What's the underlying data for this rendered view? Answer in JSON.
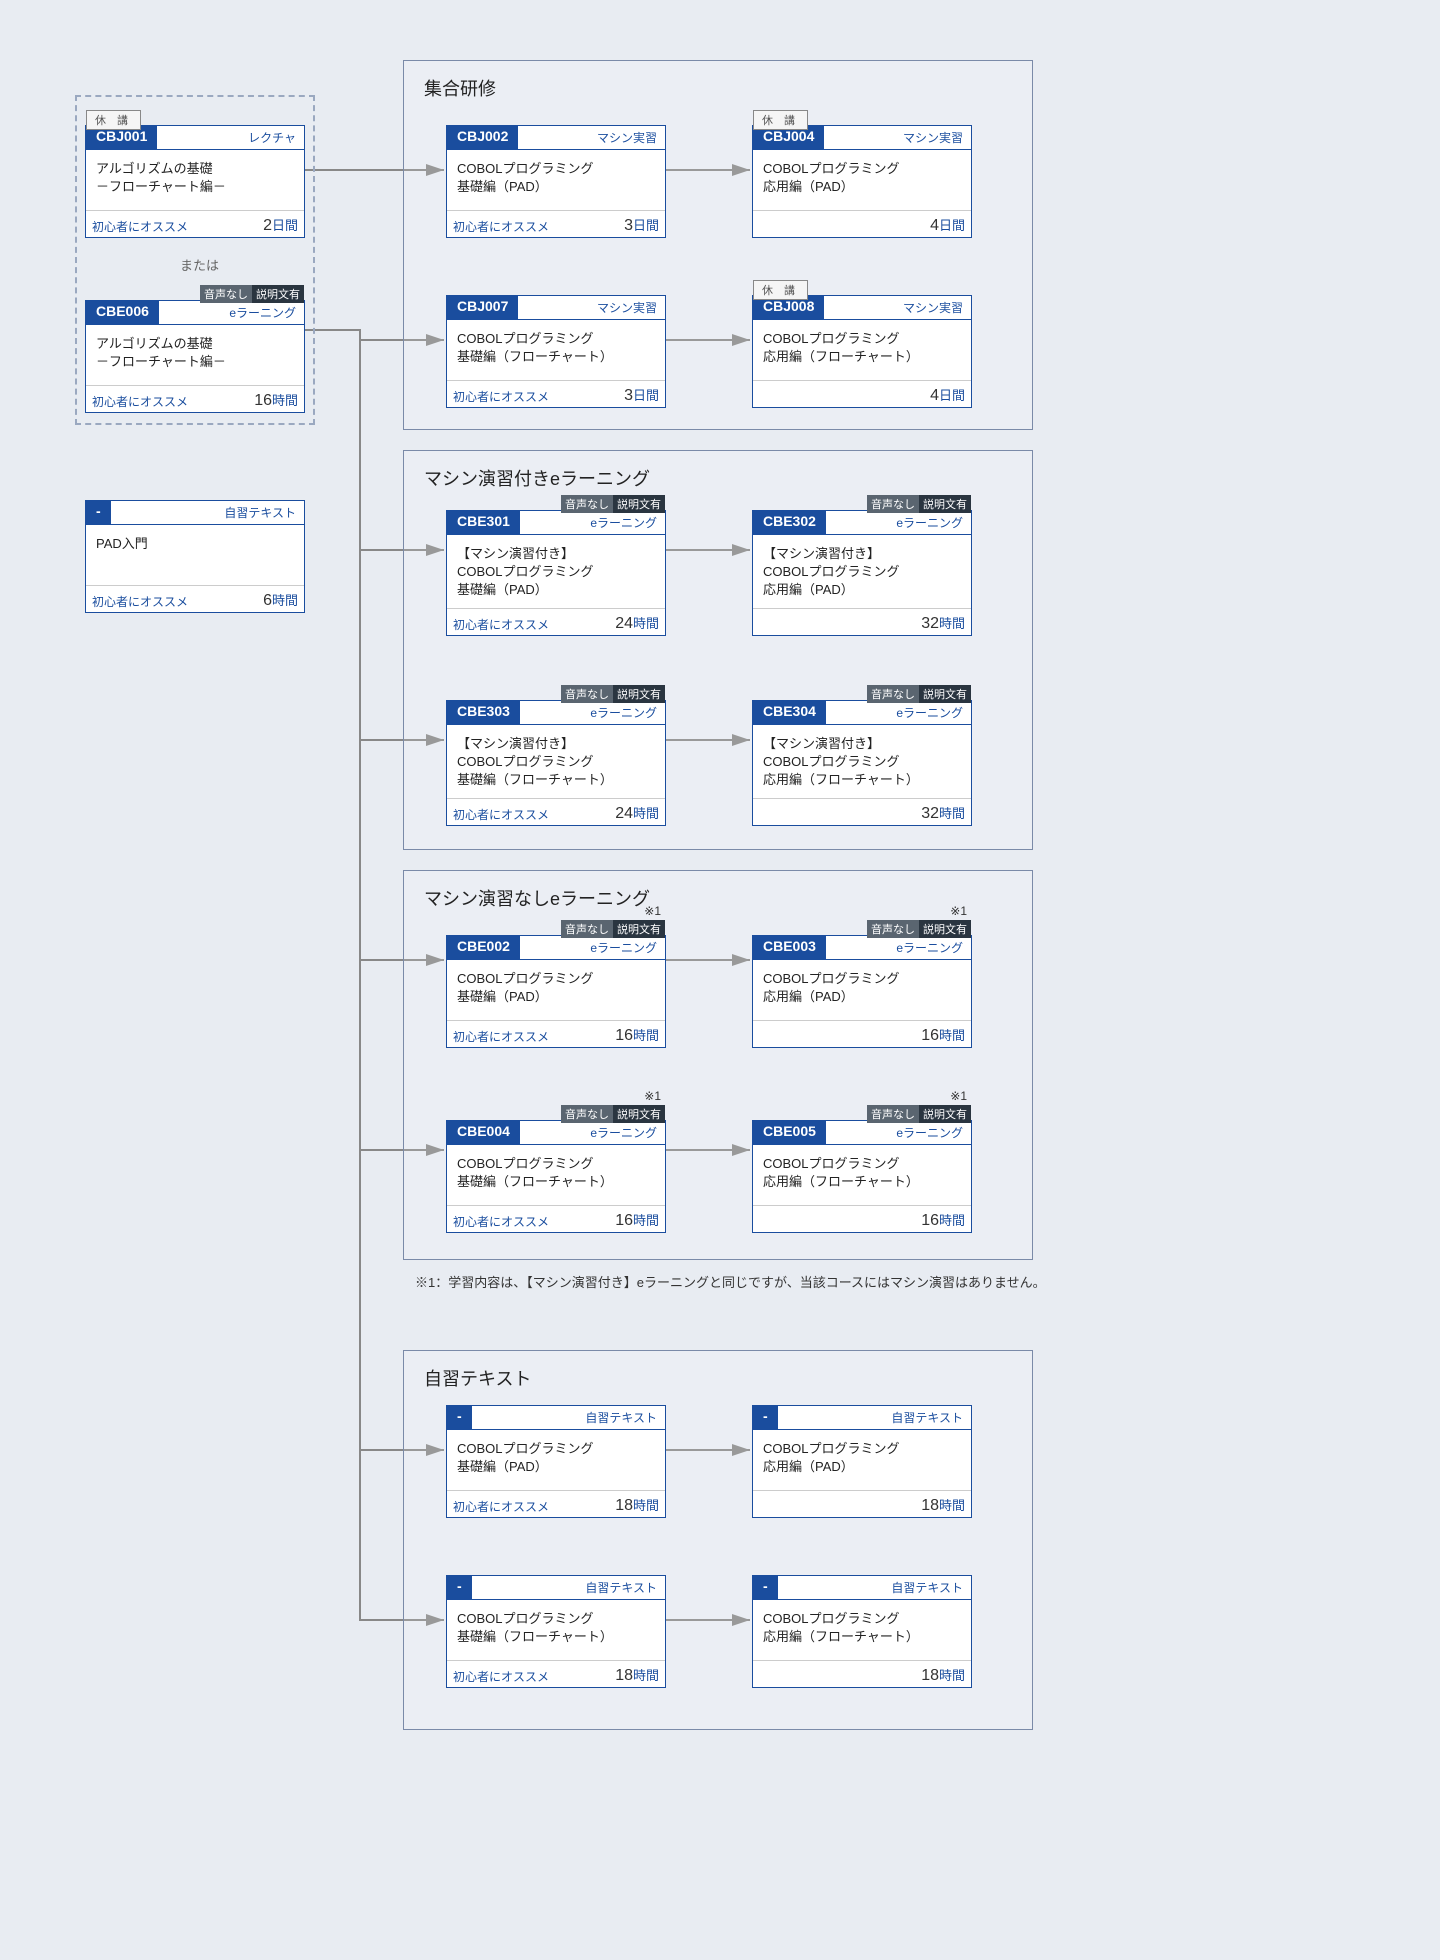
{
  "labels": {
    "cancelled": "休 講",
    "audio1": "音声なし",
    "audio2": "説明文有",
    "recommend": "初心者にオススメ",
    "or": "または",
    "ast": "※1"
  },
  "sections": {
    "s1": "集合研修",
    "s2": "マシン演習付きeラーニング",
    "s3": "マシン演習なしeラーニング",
    "s4": "自習テキスト"
  },
  "note1": "※1：学習内容は、【マシン演習付き】eラーニングと同じですが、当該コースにはマシン演習はありません。",
  "cards": {
    "cbj001": {
      "code": "CBJ001",
      "type": "レクチャ",
      "title": "アルゴリズムの基礎\n－フローチャート編－",
      "dur_num": "2",
      "dur_unit": "日間"
    },
    "cbe006": {
      "code": "CBE006",
      "type": "eラーニング",
      "title": "アルゴリズムの基礎\n－フローチャート編－",
      "dur_num": "16",
      "dur_unit": "時間"
    },
    "pad": {
      "code": "-",
      "type": "自習テキスト",
      "title": "PAD入門",
      "dur_num": "6",
      "dur_unit": "時間"
    },
    "cbj002": {
      "code": "CBJ002",
      "type": "マシン実習",
      "title": "COBOLプログラミング\n基礎編（PAD）",
      "dur_num": "3",
      "dur_unit": "日間"
    },
    "cbj004": {
      "code": "CBJ004",
      "type": "マシン実習",
      "title": "COBOLプログラミング\n応用編（PAD）",
      "dur_num": "4",
      "dur_unit": "日間"
    },
    "cbj007": {
      "code": "CBJ007",
      "type": "マシン実習",
      "title": "COBOLプログラミング\n基礎編（フローチャート）",
      "dur_num": "3",
      "dur_unit": "日間"
    },
    "cbj008": {
      "code": "CBJ008",
      "type": "マシン実習",
      "title": "COBOLプログラミング\n応用編（フローチャート）",
      "dur_num": "4",
      "dur_unit": "日間"
    },
    "cbe301": {
      "code": "CBE301",
      "type": "eラーニング",
      "title": "【マシン演習付き】\nCOBOLプログラミング\n基礎編（PAD）",
      "dur_num": "24",
      "dur_unit": "時間"
    },
    "cbe302": {
      "code": "CBE302",
      "type": "eラーニング",
      "title": "【マシン演習付き】\nCOBOLプログラミング\n応用編（PAD）",
      "dur_num": "32",
      "dur_unit": "時間"
    },
    "cbe303": {
      "code": "CBE303",
      "type": "eラーニング",
      "title": "【マシン演習付き】\nCOBOLプログラミング\n基礎編（フローチャート）",
      "dur_num": "24",
      "dur_unit": "時間"
    },
    "cbe304": {
      "code": "CBE304",
      "type": "eラーニング",
      "title": "【マシン演習付き】\nCOBOLプログラミング\n応用編（フローチャート）",
      "dur_num": "32",
      "dur_unit": "時間"
    },
    "cbe002": {
      "code": "CBE002",
      "type": "eラーニング",
      "title": "COBOLプログラミング\n基礎編（PAD）",
      "dur_num": "16",
      "dur_unit": "時間"
    },
    "cbe003": {
      "code": "CBE003",
      "type": "eラーニング",
      "title": "COBOLプログラミング\n応用編（PAD）",
      "dur_num": "16",
      "dur_unit": "時間"
    },
    "cbe004": {
      "code": "CBE004",
      "type": "eラーニング",
      "title": "COBOLプログラミング\n基礎編（フローチャート）",
      "dur_num": "16",
      "dur_unit": "時間"
    },
    "cbe005": {
      "code": "CBE005",
      "type": "eラーニング",
      "title": "COBOLプログラミング\n応用編（フローチャート）",
      "dur_num": "16",
      "dur_unit": "時間"
    },
    "sst1": {
      "code": "-",
      "type": "自習テキスト",
      "title": "COBOLプログラミング\n基礎編（PAD）",
      "dur_num": "18",
      "dur_unit": "時間"
    },
    "sst2": {
      "code": "-",
      "type": "自習テキスト",
      "title": "COBOLプログラミング\n応用編（PAD）",
      "dur_num": "18",
      "dur_unit": "時間"
    },
    "sst3": {
      "code": "-",
      "type": "自習テキスト",
      "title": "COBOLプログラミング\n基礎編（フローチャート）",
      "dur_num": "18",
      "dur_unit": "時間"
    },
    "sst4": {
      "code": "-",
      "type": "自習テキスト",
      "title": "COBOLプログラミング\n応用編（フローチャート）",
      "dur_num": "18",
      "dur_unit": "時間"
    }
  }
}
